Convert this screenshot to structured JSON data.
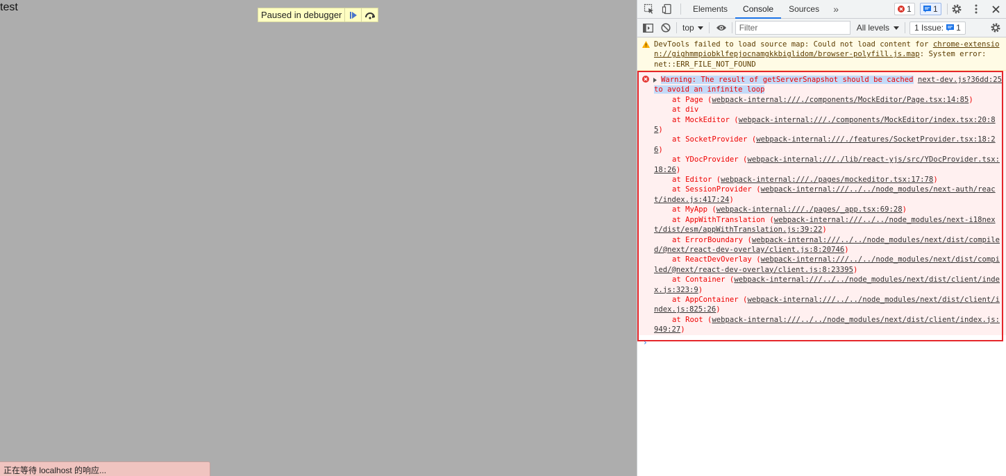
{
  "page": {
    "text": "test",
    "debugger_label": "Paused in debugger",
    "status": "正在等待 localhost 的响应..."
  },
  "devtools": {
    "tabs": [
      "Elements",
      "Console",
      "Sources"
    ],
    "active_tab": "Console",
    "error_count": "1",
    "message_count": "1",
    "context": "top",
    "filter_placeholder": "Filter",
    "levels": "All levels",
    "issues_label": "1 Issue:",
    "issues_count": "1"
  },
  "console": {
    "warning": {
      "text_before": "DevTools failed to load source map: Could not load content for ",
      "link": "chrome-extension://gighmmpiobklfepjocnamgkkbiglidom/browser-polyfill.js.map",
      "text_after": ": System error: net::ERR_FILE_NOT_FOUND"
    },
    "error": {
      "message": "Warning: The result of getServerSnapshot should be cached to avoid an infinite loop",
      "source": "next-dev.js?36dd:25",
      "stack": [
        {
          "fn": "at Page",
          "loc": "webpack-internal:///./components/MockEditor/Page.tsx:14:85"
        },
        {
          "fn": "at div",
          "loc": ""
        },
        {
          "fn": "at MockEditor",
          "loc": "webpack-internal:///./components/MockEditor/index.tsx:20:85"
        },
        {
          "fn": "at SocketProvider",
          "loc": "webpack-internal:///./features/SocketProvider.tsx:18:26"
        },
        {
          "fn": "at YDocProvider",
          "loc": "webpack-internal:///./lib/react-yjs/src/YDocProvider.tsx:18:26"
        },
        {
          "fn": "at Editor",
          "loc": "webpack-internal:///./pages/mockeditor.tsx:17:78"
        },
        {
          "fn": "at SessionProvider",
          "loc": "webpack-internal:///../../node_modules/next-auth/react/index.js:417:24"
        },
        {
          "fn": "at MyApp",
          "loc": "webpack-internal:///./pages/_app.tsx:69:28"
        },
        {
          "fn": "at AppWithTranslation",
          "loc": "webpack-internal:///../../node_modules/next-i18next/dist/esm/appWithTranslation.js:39:22"
        },
        {
          "fn": "at ErrorBoundary",
          "loc": "webpack-internal:///../../node_modules/next/dist/compiled/@next/react-dev-overlay/client.js:8:20746"
        },
        {
          "fn": "at ReactDevOverlay",
          "loc": "webpack-internal:///../../node_modules/next/dist/compiled/@next/react-dev-overlay/client.js:8:23395"
        },
        {
          "fn": "at Container",
          "loc": "webpack-internal:///../../node_modules/next/dist/client/index.js:323:9"
        },
        {
          "fn": "at AppContainer",
          "loc": "webpack-internal:///../../node_modules/next/dist/client/index.js:825:26"
        },
        {
          "fn": "at Root",
          "loc": "webpack-internal:///../../node_modules/next/dist/client/index.js:949:27"
        }
      ]
    }
  }
}
